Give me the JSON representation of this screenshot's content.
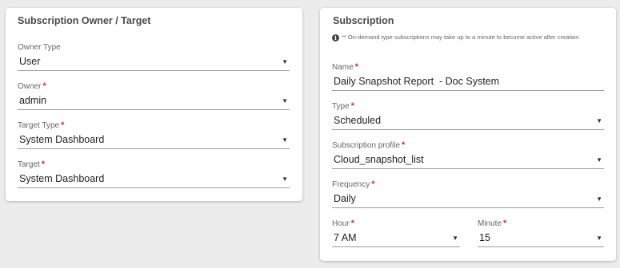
{
  "owner_card": {
    "title": "Subscription Owner / Target",
    "owner_type": {
      "label": "Owner Type",
      "value": "User"
    },
    "owner": {
      "label": "Owner",
      "value": "admin"
    },
    "target_type": {
      "label": "Target Type",
      "value": "System Dashboard"
    },
    "target": {
      "label": "Target",
      "value": "System Dashboard"
    }
  },
  "subscription_card": {
    "title": "Subscription",
    "note": "** On-demand type subscriptions may take up to a minute to become active after creation.",
    "name": {
      "label": "Name",
      "value": "Daily Snapshot Report  - Doc System"
    },
    "type": {
      "label": "Type",
      "value": "Scheduled"
    },
    "profile": {
      "label": "Subscription profile",
      "value": "Cloud_snapshot_list"
    },
    "frequency": {
      "label": "Frequency",
      "value": "Daily"
    },
    "hour": {
      "label": "Hour",
      "value": "7 AM"
    },
    "minute": {
      "label": "Minute",
      "value": "15"
    }
  },
  "symbols": {
    "required": "*",
    "caret": "▼",
    "info": "i"
  },
  "colors": {
    "required": "#c0392b",
    "background": "#ececec",
    "card": "#ffffff"
  }
}
